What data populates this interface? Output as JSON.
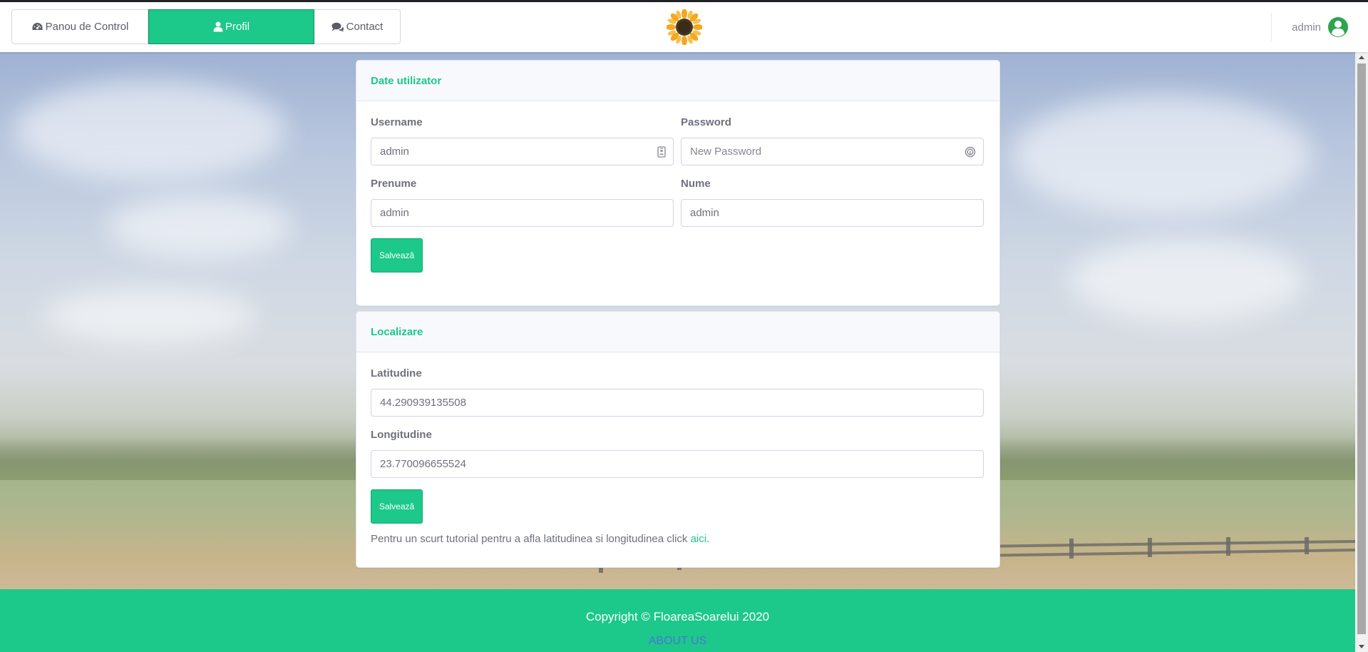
{
  "nav": {
    "tabs": [
      {
        "label": "Panou de Control",
        "icon": "dashboard-icon"
      },
      {
        "label": "Profil",
        "icon": "user-icon",
        "active": true
      },
      {
        "label": "Contact",
        "icon": "comments-icon"
      }
    ],
    "logo_icon": "sunflower-logo",
    "user_name": "admin",
    "user_icon": "user-circle-icon"
  },
  "user_card": {
    "title": "Date utilizator",
    "username_label": "Username",
    "username_value": "admin",
    "password_label": "Password",
    "password_placeholder": "New Password",
    "prenume_label": "Prenume",
    "prenume_value": "admin",
    "nume_label": "Nume",
    "nume_value": "admin",
    "save_label": "Salvează"
  },
  "location_card": {
    "title": "Localizare",
    "lat_label": "Latitudine",
    "lat_value": "44.290939135508",
    "lon_label": "Longitudine",
    "lon_value": "23.770096655524",
    "save_label": "Salvează",
    "hint_text": "Pentru un scurt tutorial pentru a afla latitudinea si longitudinea click ",
    "hint_link": "aici",
    "hint_end": "."
  },
  "footer": {
    "copyright": "Copyright © FloareaSoarelui 2020",
    "about": "ABOUT US"
  },
  "colors": {
    "accent": "#1cc88a",
    "link_blue": "#4e73df"
  }
}
